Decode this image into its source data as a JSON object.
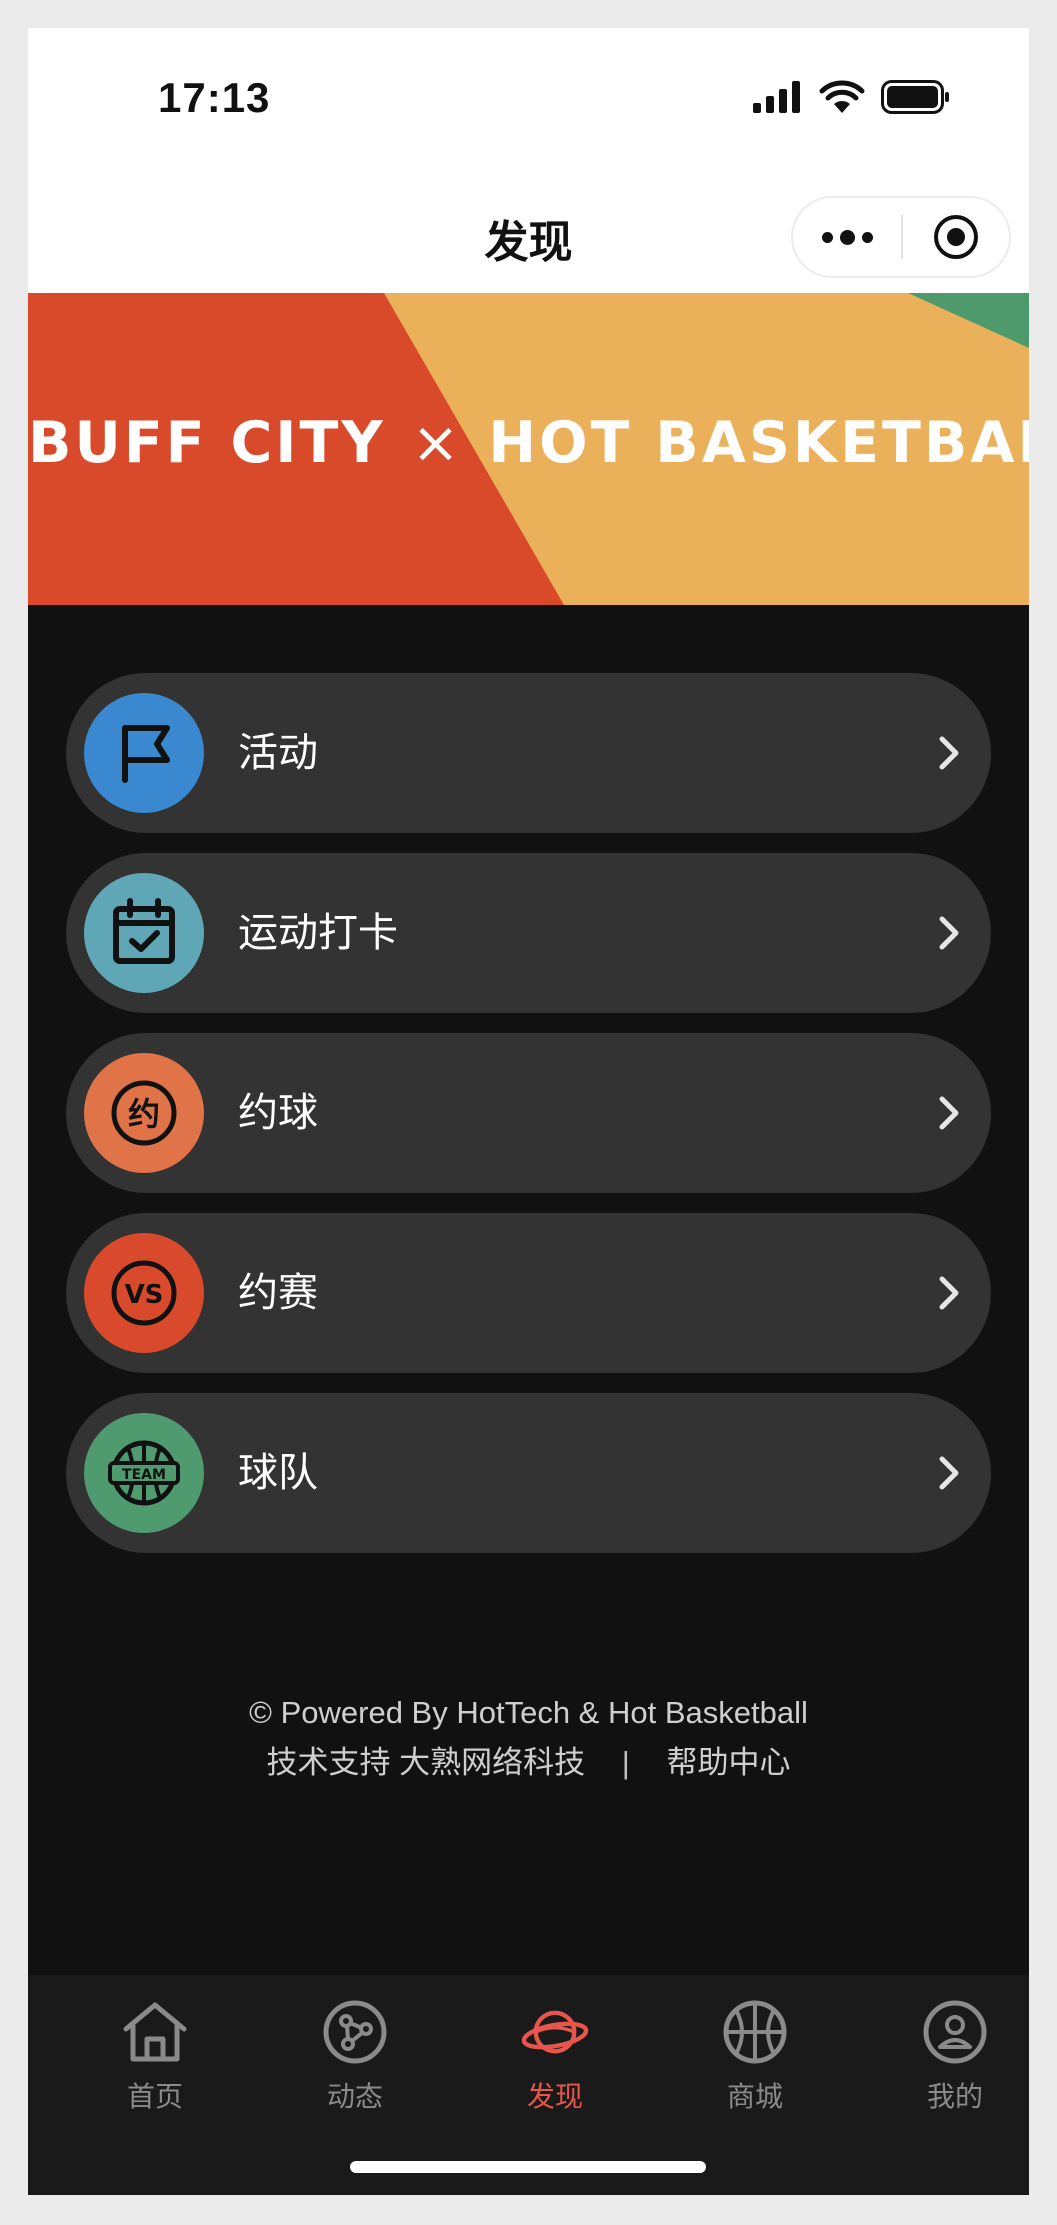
{
  "status_bar": {
    "time": "17:13"
  },
  "nav": {
    "title": "发现"
  },
  "banner": {
    "left_text": "BUFF CITY",
    "separator": "×",
    "right_text": "HOT BASKETBALL",
    "colors": {
      "red": "#d84a2a",
      "orange": "#ebb05a",
      "green": "#4e9a6c"
    }
  },
  "menu": {
    "items": [
      {
        "label": "活动",
        "icon": "flag-icon",
        "icon_bg": "#3a88d0"
      },
      {
        "label": "运动打卡",
        "icon": "calendar-check-icon",
        "icon_bg": "#5fa7b6"
      },
      {
        "label": "约球",
        "icon": "yue-badge-icon",
        "icon_text": "约",
        "icon_bg": "#e07448"
      },
      {
        "label": "约赛",
        "icon": "vs-badge-icon",
        "icon_text": "VS",
        "icon_bg": "#d94a2c"
      },
      {
        "label": "球队",
        "icon": "team-ball-icon",
        "icon_text": "TEAM",
        "icon_bg": "#4f9b6f"
      }
    ]
  },
  "footer": {
    "powered": "© Powered By HotTech & Hot Basketball",
    "support": "技术支持 大熟网络科技",
    "separator": "|",
    "help": "帮助中心"
  },
  "tabbar": {
    "active_color": "#e8564b",
    "inactive_color": "#8a8a8a",
    "items": [
      {
        "label": "首页",
        "icon": "home-icon",
        "active": false
      },
      {
        "label": "动态",
        "icon": "share-nodes-icon",
        "active": false
      },
      {
        "label": "发现",
        "icon": "planet-icon",
        "active": true
      },
      {
        "label": "商城",
        "icon": "basketball-icon",
        "active": false
      },
      {
        "label": "我的",
        "icon": "user-circle-icon",
        "active": false
      }
    ]
  }
}
